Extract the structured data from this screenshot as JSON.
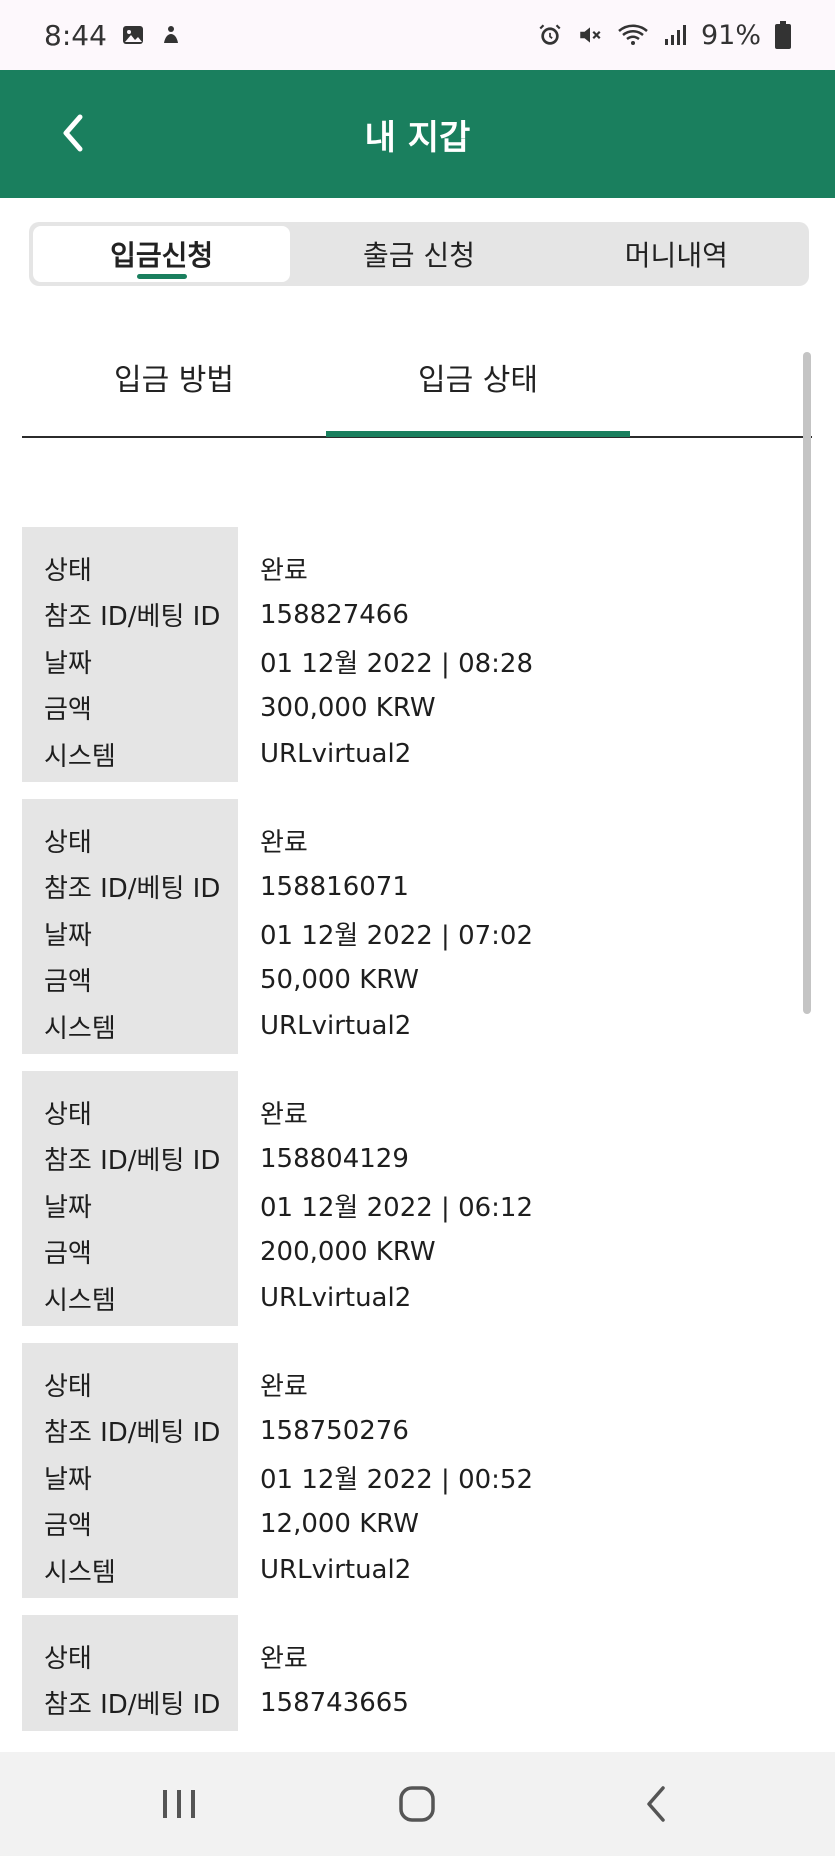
{
  "status_bar": {
    "time": "8:44",
    "battery": "91%",
    "icons": [
      "image-icon",
      "notification-icon",
      "alarm-icon",
      "mute-icon",
      "wifi-icon",
      "signal-icon",
      "battery-icon"
    ]
  },
  "header": {
    "title": "내 지갑",
    "accent_color": "#1a7f5e"
  },
  "segment_tabs": [
    {
      "label": "입금신청",
      "active": true
    },
    {
      "label": "출금 신청",
      "active": false
    },
    {
      "label": "머니내역",
      "active": false
    }
  ],
  "sub_tabs": [
    {
      "label": "입금 방법",
      "active": false
    },
    {
      "label": "입금 상태",
      "active": true
    }
  ],
  "field_labels": {
    "status": "상태",
    "ref_id": "참조 ID/베팅 ID",
    "date": "날짜",
    "amount": "금액",
    "system": "시스템"
  },
  "deposits": [
    {
      "status": "완료",
      "ref_id": "158827466",
      "date": "01 12월 2022 | 08:28",
      "amount": "300,000 KRW",
      "system": "URLvirtual2"
    },
    {
      "status": "완료",
      "ref_id": "158816071",
      "date": "01 12월 2022 | 07:02",
      "amount": "50,000 KRW",
      "system": "URLvirtual2"
    },
    {
      "status": "완료",
      "ref_id": "158804129",
      "date": "01 12월 2022 | 06:12",
      "amount": "200,000 KRW",
      "system": "URLvirtual2"
    },
    {
      "status": "완료",
      "ref_id": "158750276",
      "date": "01 12월 2022 | 00:52",
      "amount": "12,000 KRW",
      "system": "URLvirtual2"
    },
    {
      "status": "완료",
      "ref_id": "158743665"
    }
  ]
}
